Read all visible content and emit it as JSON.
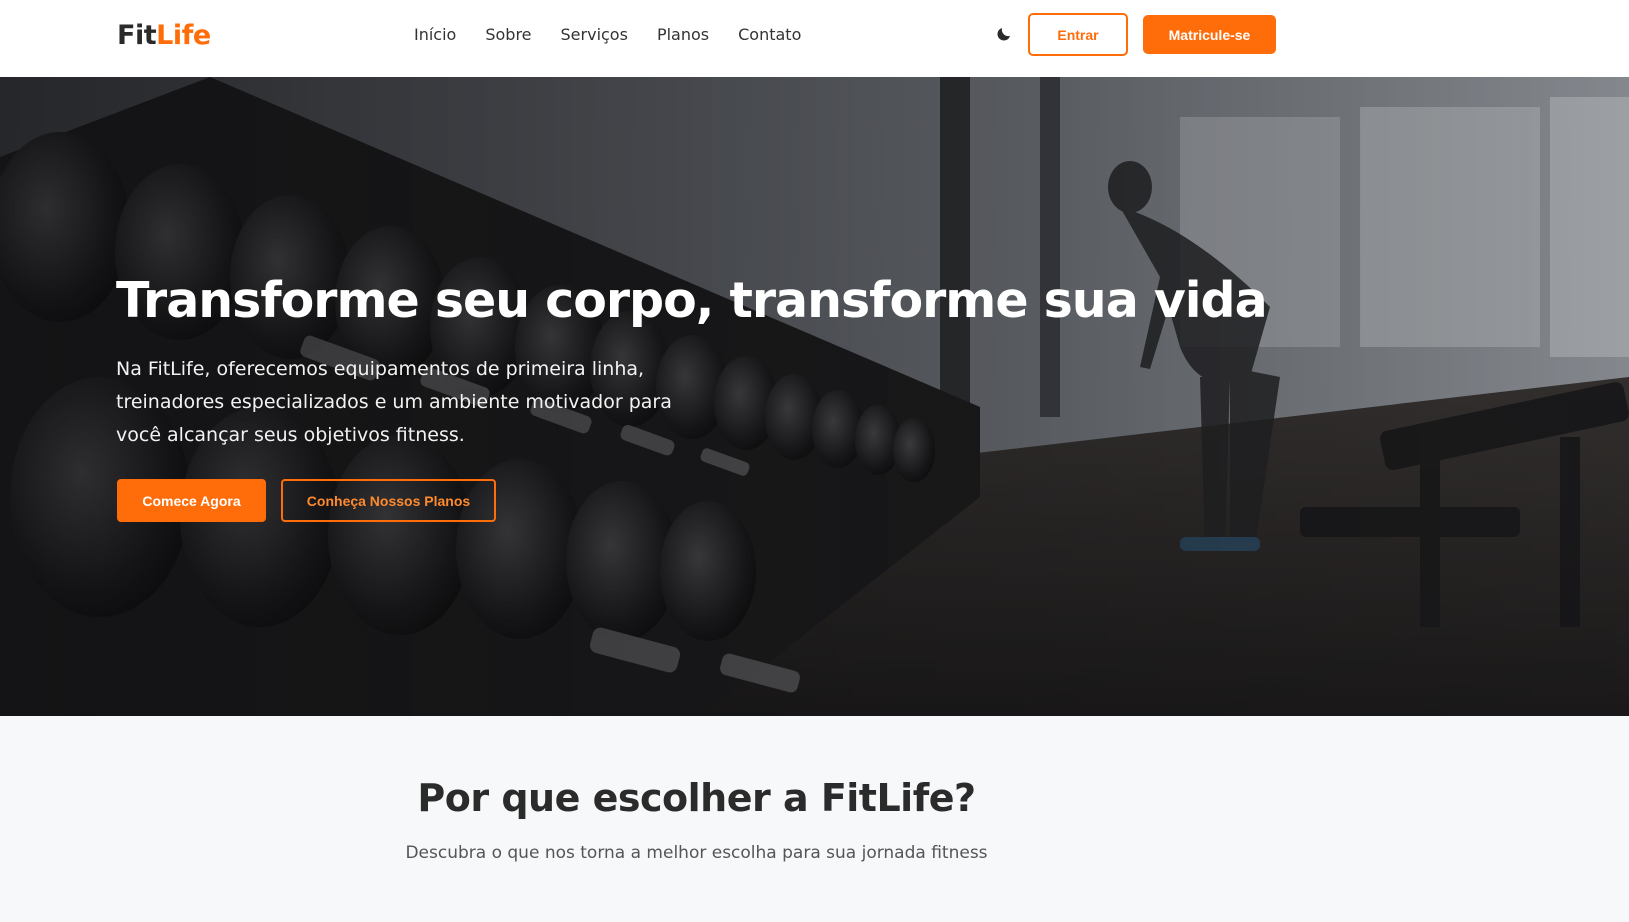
{
  "brand": {
    "name_part1": "Fit",
    "name_part2": "Life",
    "accent_color": "#ff6d0a",
    "text_color": "#2b2b2b"
  },
  "nav": {
    "links": [
      {
        "label": "Início"
      },
      {
        "label": "Sobre"
      },
      {
        "label": "Serviços"
      },
      {
        "label": "Planos"
      },
      {
        "label": "Contato"
      }
    ],
    "theme_toggle_icon": "moon-icon",
    "login_label": "Entrar",
    "signup_label": "Matricule-se"
  },
  "hero": {
    "title": "Transforme seu corpo, transforme sua vida",
    "text": "Na FitLife, oferecemos equipamentos de primeira linha, treinadores especializados e um ambiente motivador para você alcançar seus objetivos fitness.",
    "primary_cta": "Comece Agora",
    "secondary_cta": "Conheça Nossos Planos",
    "background": "gym-dumbbell-rack-photo"
  },
  "why": {
    "title": "Por que escolher a FitLife?",
    "subtitle": "Descubra o que nos torna a melhor escolha para sua jornada fitness"
  }
}
